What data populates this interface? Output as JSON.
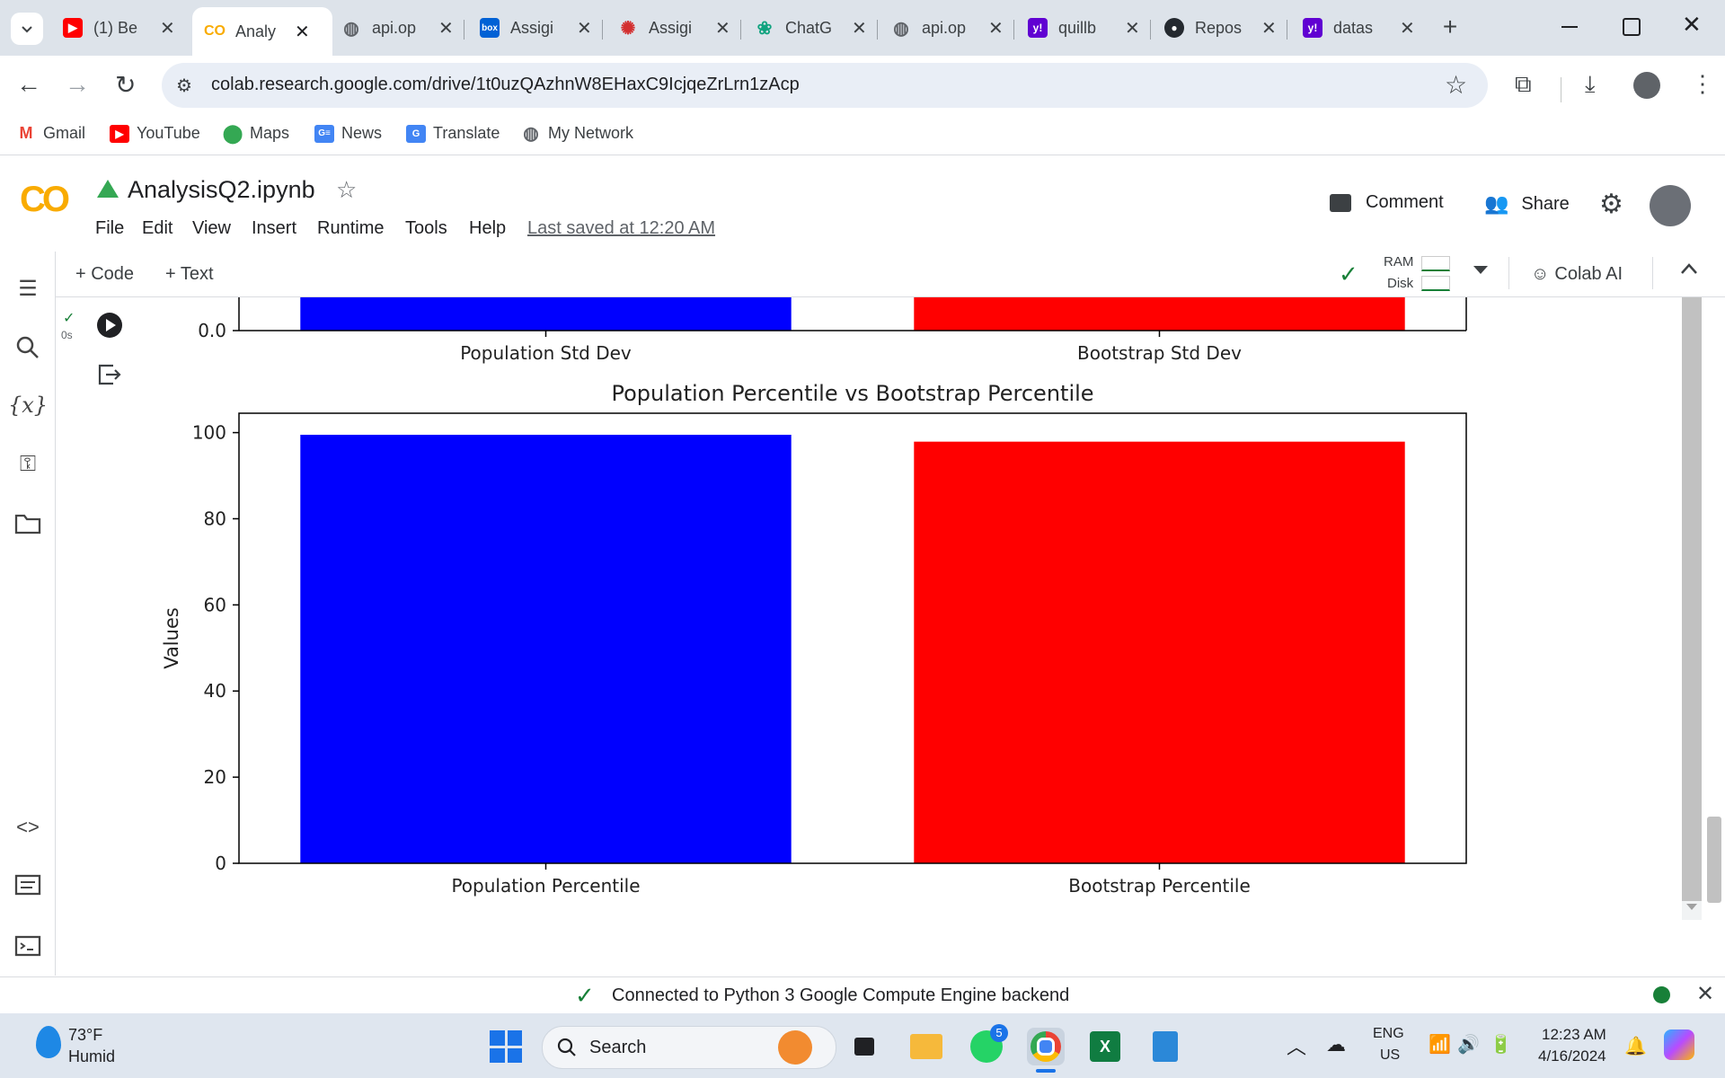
{
  "browser": {
    "tabs": [
      {
        "title": "(1) Be",
        "icon": "youtube-icon",
        "active": false
      },
      {
        "title": "Analy",
        "icon": "colab-icon",
        "active": true
      },
      {
        "title": "api.op",
        "icon": "globe-icon",
        "active": false
      },
      {
        "title": "Assigi",
        "icon": "box-icon",
        "active": false
      },
      {
        "title": "Assigi",
        "icon": "asu-icon",
        "active": false
      },
      {
        "title": "ChatG",
        "icon": "chatgpt-icon",
        "active": false
      },
      {
        "title": "api.op",
        "icon": "globe-icon",
        "active": false
      },
      {
        "title": "quillb",
        "icon": "yahoo-icon",
        "active": false
      },
      {
        "title": "Repos",
        "icon": "github-icon",
        "active": false
      },
      {
        "title": "datas",
        "icon": "yahoo-icon",
        "active": false
      }
    ],
    "url": "colab.research.google.com/drive/1t0uzQAzhnW8EHaxC9IcjqeZrLrn1zAcp",
    "bookmarks": [
      {
        "label": "Gmail",
        "icon": "gmail-icon"
      },
      {
        "label": "YouTube",
        "icon": "youtube-icon"
      },
      {
        "label": "Maps",
        "icon": "maps-icon"
      },
      {
        "label": "News",
        "icon": "news-icon"
      },
      {
        "label": "Translate",
        "icon": "translate-icon"
      },
      {
        "label": "My Network",
        "icon": "globe-icon"
      }
    ]
  },
  "colab": {
    "logo": "CO",
    "filename": "AnalysisQ2.ipynb",
    "menu": [
      "File",
      "Edit",
      "View",
      "Insert",
      "Runtime",
      "Tools",
      "Help"
    ],
    "last_saved": "Last saved at 12:20 AM",
    "comment_label": "Comment",
    "share_label": "Share",
    "add_code": "+ Code",
    "add_text": "+ Text",
    "ram_label": "RAM",
    "disk_label": "Disk",
    "colab_ai": "Colab AI",
    "cell_exec_time": "0s",
    "status_text": "Connected to Python 3 Google Compute Engine backend"
  },
  "chart_data": [
    {
      "type": "bar",
      "categories": [
        "Population Std Dev",
        "Bootstrap Std Dev"
      ],
      "colors": [
        "#0000ff",
        "#ff0000"
      ],
      "partially_visible": true,
      "visible_ticks": [
        "0.0"
      ]
    },
    {
      "type": "bar",
      "title": "Population Percentile vs Bootstrap Percentile",
      "categories": [
        "Population Percentile",
        "Bootstrap Percentile"
      ],
      "values": [
        99.5,
        97.9
      ],
      "colors": [
        "#0000ff",
        "#ff0000"
      ],
      "ylabel": "Values",
      "ylim": [
        0,
        104.5
      ],
      "yticks": [
        "0",
        "20",
        "40",
        "60",
        "80",
        "100"
      ],
      "grid": false
    }
  ],
  "taskbar": {
    "weather_temp": "73°F",
    "weather_desc": "Humid",
    "search_placeholder": "Search",
    "whatsapp_badge": "5",
    "lang_top": "ENG",
    "lang_bottom": "US",
    "time": "12:23 AM",
    "date": "4/16/2024"
  }
}
